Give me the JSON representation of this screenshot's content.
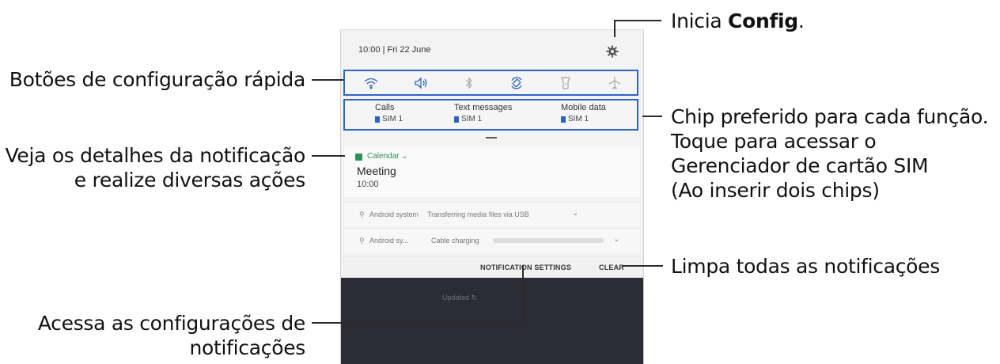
{
  "callouts": {
    "settings_prefix": "Inicia ",
    "settings_bold": "Config",
    "settings_suffix": ".",
    "quick_buttons": "Botões de configuração rápida",
    "sim_line1": "Chip preferido para cada função.",
    "sim_line2": "Toque para acessar o",
    "sim_line3": "Gerenciador de cartão SIM",
    "sim_line4": "(Ao inserir dois chips)",
    "details_line1": "Veja os detalhes da notificação",
    "details_line2": "e realize diversas ações",
    "clear_all": "Limpa todas as notificações",
    "notif_settings_line1": "Acessa as configurações de",
    "notif_settings_line2": "notificações"
  },
  "phone": {
    "status_time": "10:00 | Fri 22 June",
    "settings_icon": "gear-icon",
    "quick_settings": [
      {
        "icon": "wifi-icon"
      },
      {
        "icon": "sound-icon"
      },
      {
        "icon": "bluetooth-icon"
      },
      {
        "icon": "auto-rotate-icon"
      },
      {
        "icon": "flashlight-icon"
      },
      {
        "icon": "airplane-mode-icon"
      }
    ],
    "sim": [
      {
        "title": "Calls",
        "value": "SIM 1"
      },
      {
        "title": "Text messages",
        "value": "SIM 1"
      },
      {
        "title": "Mobile data",
        "value": "SIM 1"
      }
    ],
    "calendar_notification": {
      "app": "Calendar",
      "title": "Meeting",
      "time": "10:00"
    },
    "system_notification_1": {
      "app": "Android system",
      "message": "Transferring media files via USB"
    },
    "system_notification_2": {
      "app": "Android sy...",
      "message": "Cable charging"
    },
    "notification_settings_label": "NOTIFICATION SETTINGS",
    "clear_label": "CLEAR",
    "updated_label": "Updated"
  },
  "colors": {
    "highlight": "#2e63c6",
    "calendar_accent": "#2f8f5b",
    "dark_panel": "#2b2c35"
  }
}
